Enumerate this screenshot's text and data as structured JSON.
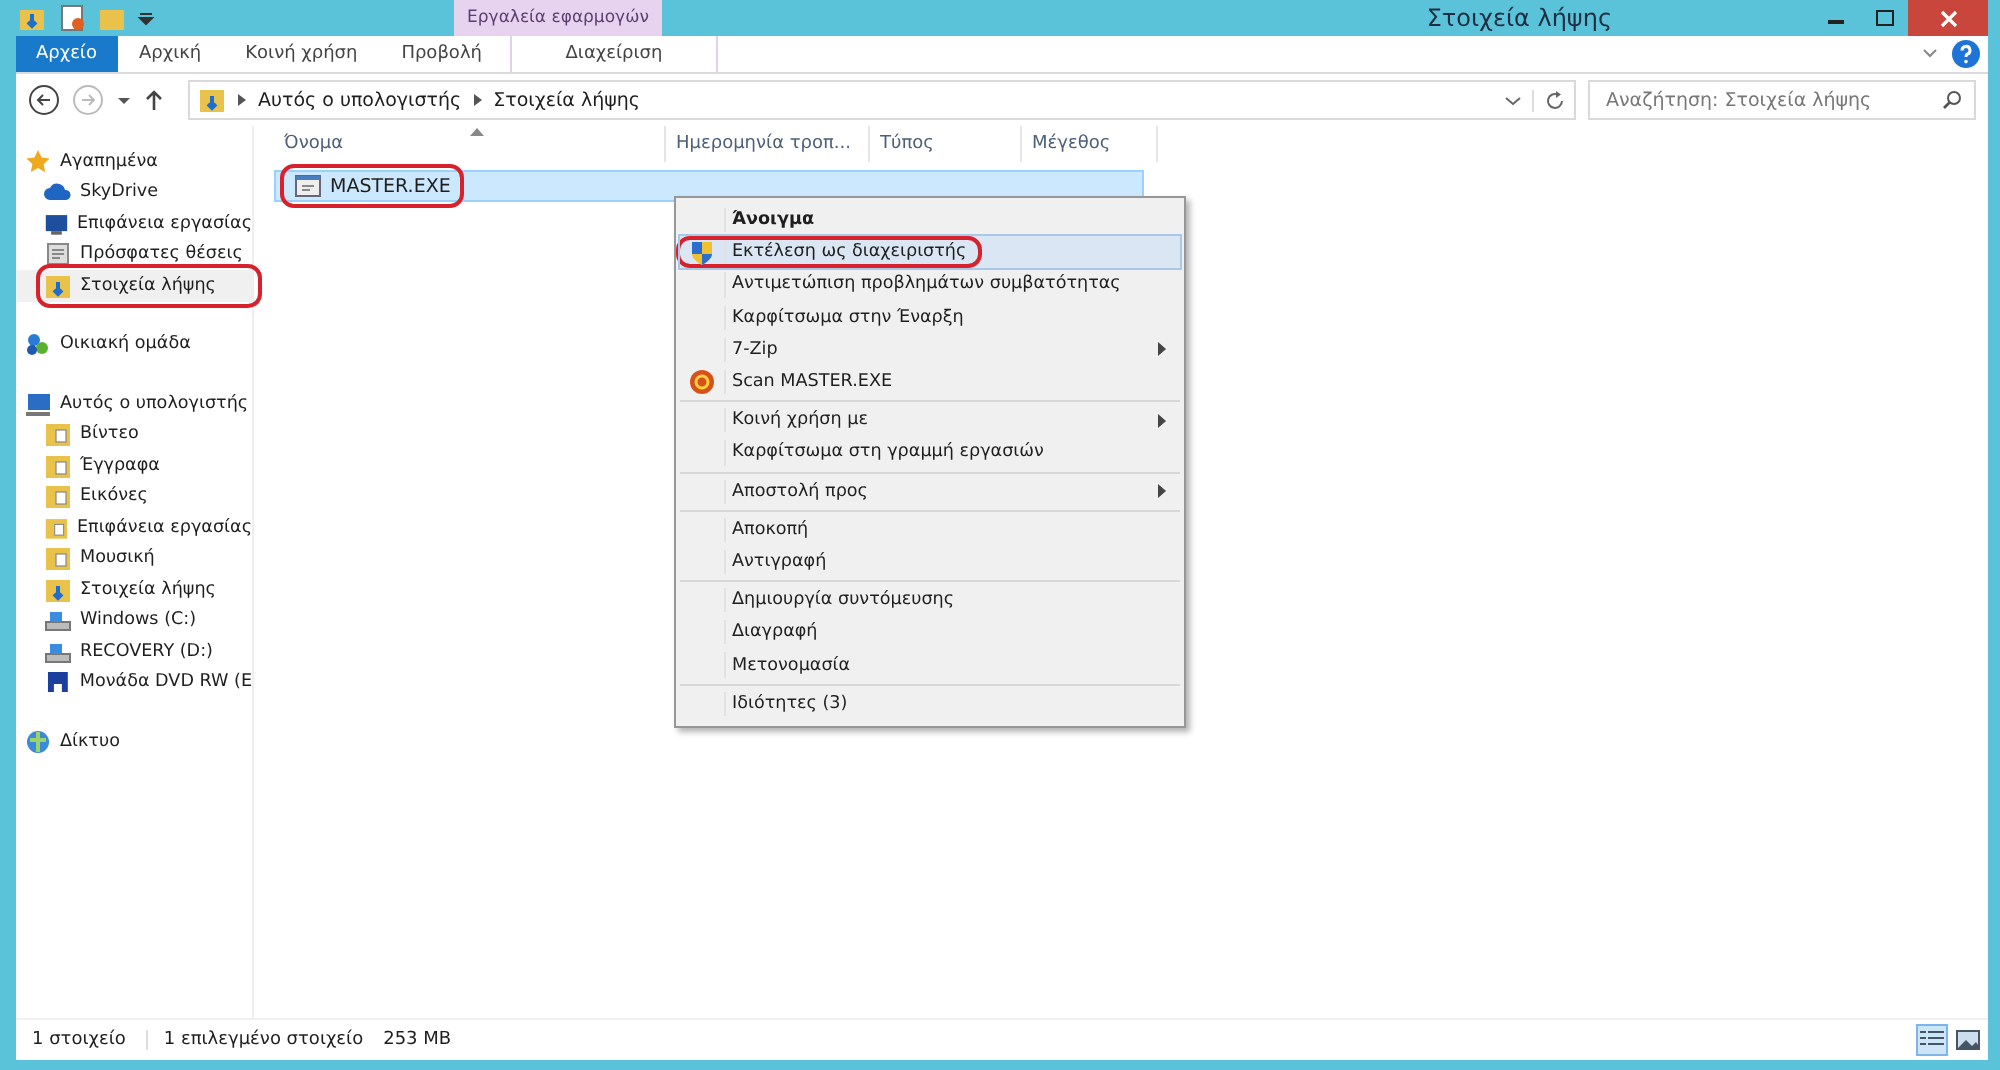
{
  "window": {
    "title": "Στοιχεία λήψης"
  },
  "ribbon": {
    "context_group": "Εργαλεία εφαρμογών",
    "tabs": [
      {
        "label": "Αρχείο",
        "kind": "file",
        "selected": false
      },
      {
        "label": "Αρχική",
        "kind": "tab",
        "selected": false
      },
      {
        "label": "Κοινή χρήση",
        "kind": "tab",
        "selected": false
      },
      {
        "label": "Προβολή",
        "kind": "tab",
        "selected": false
      },
      {
        "label": "Διαχείριση",
        "kind": "context",
        "selected": false
      }
    ]
  },
  "address_bar": {
    "path": [
      "Αυτός ο υπολογιστής",
      "Στοιχεία λήψης"
    ]
  },
  "search": {
    "placeholder": "Αναζήτηση: Στοιχεία λήψης"
  },
  "sidebar": {
    "groups": [
      {
        "label": "Αγαπημένα",
        "children": [
          {
            "label": "SkyDrive",
            "selected": false,
            "highlighted": false
          },
          {
            "label": "Επιφάνεια εργασίας",
            "selected": false,
            "highlighted": false
          },
          {
            "label": "Πρόσφατες θέσεις",
            "selected": false,
            "highlighted": false
          },
          {
            "label": "Στοιχεία λήψης",
            "selected": true,
            "highlighted": true
          }
        ]
      },
      {
        "label": "Οικιακή ομάδα"
      },
      {
        "label": "Αυτός ο υπολογιστής",
        "children": [
          {
            "label": "Βίντεο",
            "selected": false,
            "highlighted": false
          },
          {
            "label": "Έγγραφα",
            "selected": false,
            "highlighted": false
          },
          {
            "label": "Εικόνες",
            "selected": false,
            "highlighted": false
          },
          {
            "label": "Επιφάνεια εργασίας",
            "selected": false,
            "highlighted": false
          },
          {
            "label": "Μουσική",
            "selected": false,
            "highlighted": false
          },
          {
            "label": "Στοιχεία λήψης",
            "selected": false,
            "highlighted": false
          },
          {
            "label": "Windows (C:)",
            "selected": false,
            "highlighted": false
          },
          {
            "label": "RECOVERY (D:)",
            "selected": false,
            "highlighted": false
          },
          {
            "label": "Μονάδα DVD RW (E",
            "selected": false,
            "highlighted": false
          }
        ]
      },
      {
        "label": "Δίκτυο"
      }
    ]
  },
  "columns": [
    {
      "label": "Όνομα",
      "sorted": true
    },
    {
      "label": "Ημερομηνία τροπ...",
      "sorted": false
    },
    {
      "label": "Τύπος",
      "sorted": false
    },
    {
      "label": "Μέγεθος",
      "sorted": false
    }
  ],
  "files": [
    {
      "name": "MASTER.EXE",
      "selected": true,
      "highlighted": true
    }
  ],
  "context_menu": {
    "sections": [
      [
        {
          "label": "Άνοιγμα",
          "default": true,
          "submenu": false,
          "selected": false,
          "highlighted": false
        },
        {
          "label": "Εκτέλεση ως διαχειριστής",
          "default": false,
          "submenu": false,
          "selected": true,
          "highlighted": true
        },
        {
          "label": "Αντιμετώπιση προβλημάτων συμβατότητας",
          "default": false,
          "submenu": false,
          "selected": false,
          "highlighted": false
        },
        {
          "label": "Καρφίτσωμα στην Έναρξη",
          "default": false,
          "submenu": false,
          "selected": false,
          "highlighted": false
        },
        {
          "label": "7-Zip",
          "default": false,
          "submenu": true,
          "selected": false,
          "highlighted": false
        },
        {
          "label": "Scan MASTER.EXE",
          "default": false,
          "submenu": false,
          "selected": false,
          "highlighted": false
        }
      ],
      [
        {
          "label": "Κοινή χρήση με",
          "default": false,
          "submenu": true,
          "selected": false,
          "highlighted": false
        },
        {
          "label": "Καρφίτσωμα στη γραμμή εργασιών",
          "default": false,
          "submenu": false,
          "selected": false,
          "highlighted": false
        }
      ],
      [
        {
          "label": "Αποστολή προς",
          "default": false,
          "submenu": true,
          "selected": false,
          "highlighted": false
        }
      ],
      [
        {
          "label": "Αποκοπή",
          "default": false,
          "submenu": false,
          "selected": false,
          "highlighted": false
        },
        {
          "label": "Αντιγραφή",
          "default": false,
          "submenu": false,
          "selected": false,
          "highlighted": false
        }
      ],
      [
        {
          "label": "Δημιουργία συντόμευσης",
          "default": false,
          "submenu": false,
          "selected": false,
          "highlighted": false
        },
        {
          "label": "Διαγραφή",
          "default": false,
          "submenu": false,
          "selected": false,
          "highlighted": false
        },
        {
          "label": "Μετονομασία",
          "default": false,
          "submenu": false,
          "selected": false,
          "highlighted": false
        }
      ],
      [
        {
          "label": "Ιδιότητες (3)",
          "default": false,
          "submenu": false,
          "selected": false,
          "highlighted": false
        }
      ]
    ]
  },
  "status_bar": {
    "item_count": "1 στοιχείο",
    "selection": "1 επιλεγμένο στοιχείο",
    "size": "253 MB",
    "views": [
      {
        "kind": "details",
        "selected": true
      },
      {
        "kind": "thumbnails",
        "selected": false
      }
    ]
  }
}
